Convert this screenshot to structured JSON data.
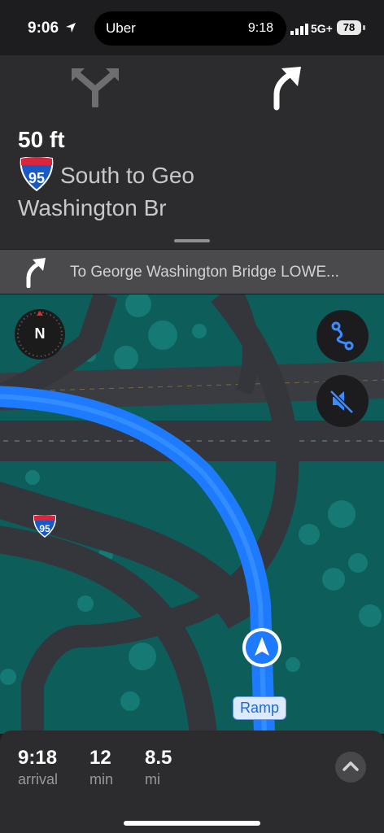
{
  "status_bar": {
    "time": "9:06",
    "island_app": "Uber",
    "island_time": "9:18",
    "network": "5G+",
    "battery": "78"
  },
  "guidance": {
    "distance": "50 ft",
    "shield_number": "95",
    "road_line1": "South to Geo",
    "road_line2": "Washington Br"
  },
  "next_maneuver": {
    "text": "To George Washington Bridge LOWE..."
  },
  "map": {
    "compass": "N",
    "route_shield": "95",
    "ramp_label": "Ramp"
  },
  "trip": {
    "arrival_value": "9:18",
    "arrival_label": "arrival",
    "minutes_value": "12",
    "minutes_label": "min",
    "distance_value": "8.5",
    "distance_label": "mi"
  },
  "colors": {
    "route_blue": "#1e7bff",
    "map_green": "#0d5e5b",
    "panel": "#2c2c2e"
  }
}
